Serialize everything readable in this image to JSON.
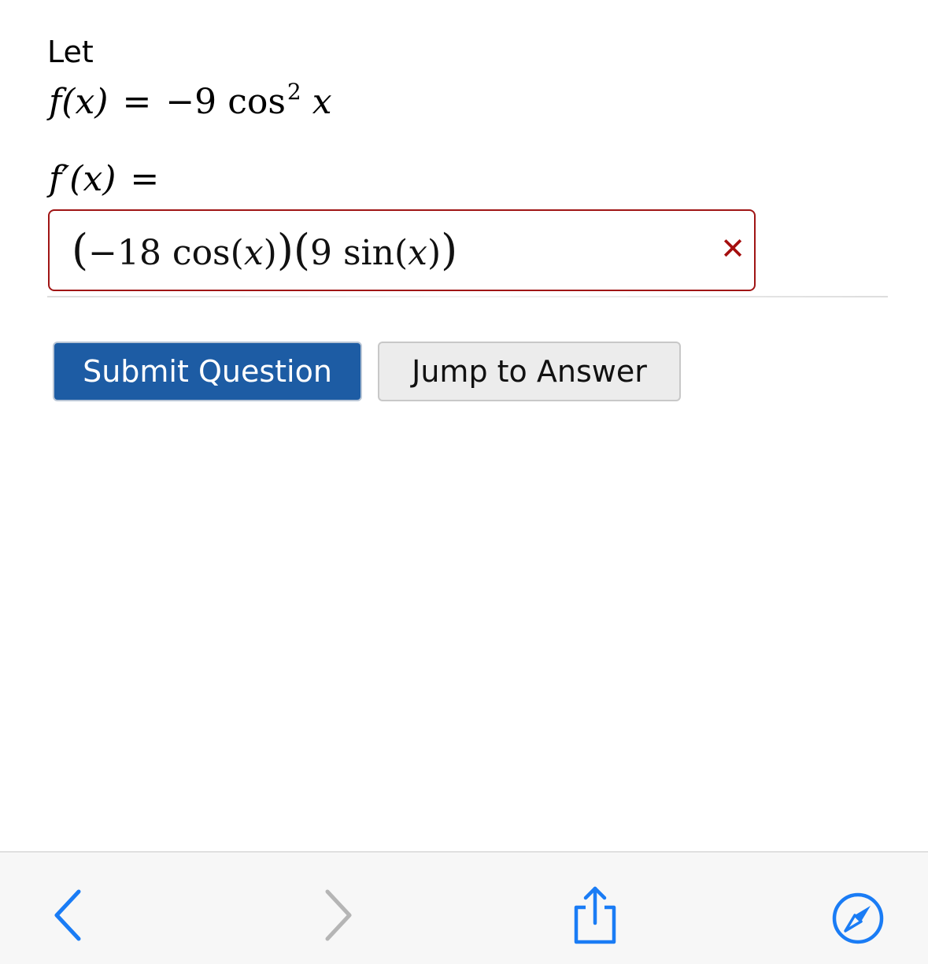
{
  "question": {
    "let_label": "Let",
    "function_lhs": "f(x)",
    "equals": "=",
    "function_rhs_coeff": "−9",
    "function_rhs_func": "cos",
    "function_rhs_power": "2",
    "function_rhs_var": "x",
    "derivative_lhs": "f′(x)"
  },
  "answer": {
    "open1": "(",
    "part1": "−18 cos",
    "var1_open": "(",
    "var1": "x",
    "var1_close": ")",
    "close1": ")",
    "open2": "(",
    "part2": "9 sin",
    "var2_open": "(",
    "var2": "x",
    "var2_close": ")",
    "close2": ")",
    "status_mark": "✕",
    "status": "incorrect"
  },
  "buttons": {
    "submit_label": "Submit Question",
    "jump_label": "Jump to Answer"
  },
  "toolbar": {
    "back_icon": "chevron-left-icon",
    "forward_icon": "chevron-right-icon",
    "share_icon": "share-icon",
    "compass_icon": "compass-icon"
  },
  "colors": {
    "submit_bg": "#1d5ca4",
    "error": "#a01515",
    "toolbar_icon_active": "#1a7cf5",
    "toolbar_icon_disabled": "#b5b5b5"
  }
}
